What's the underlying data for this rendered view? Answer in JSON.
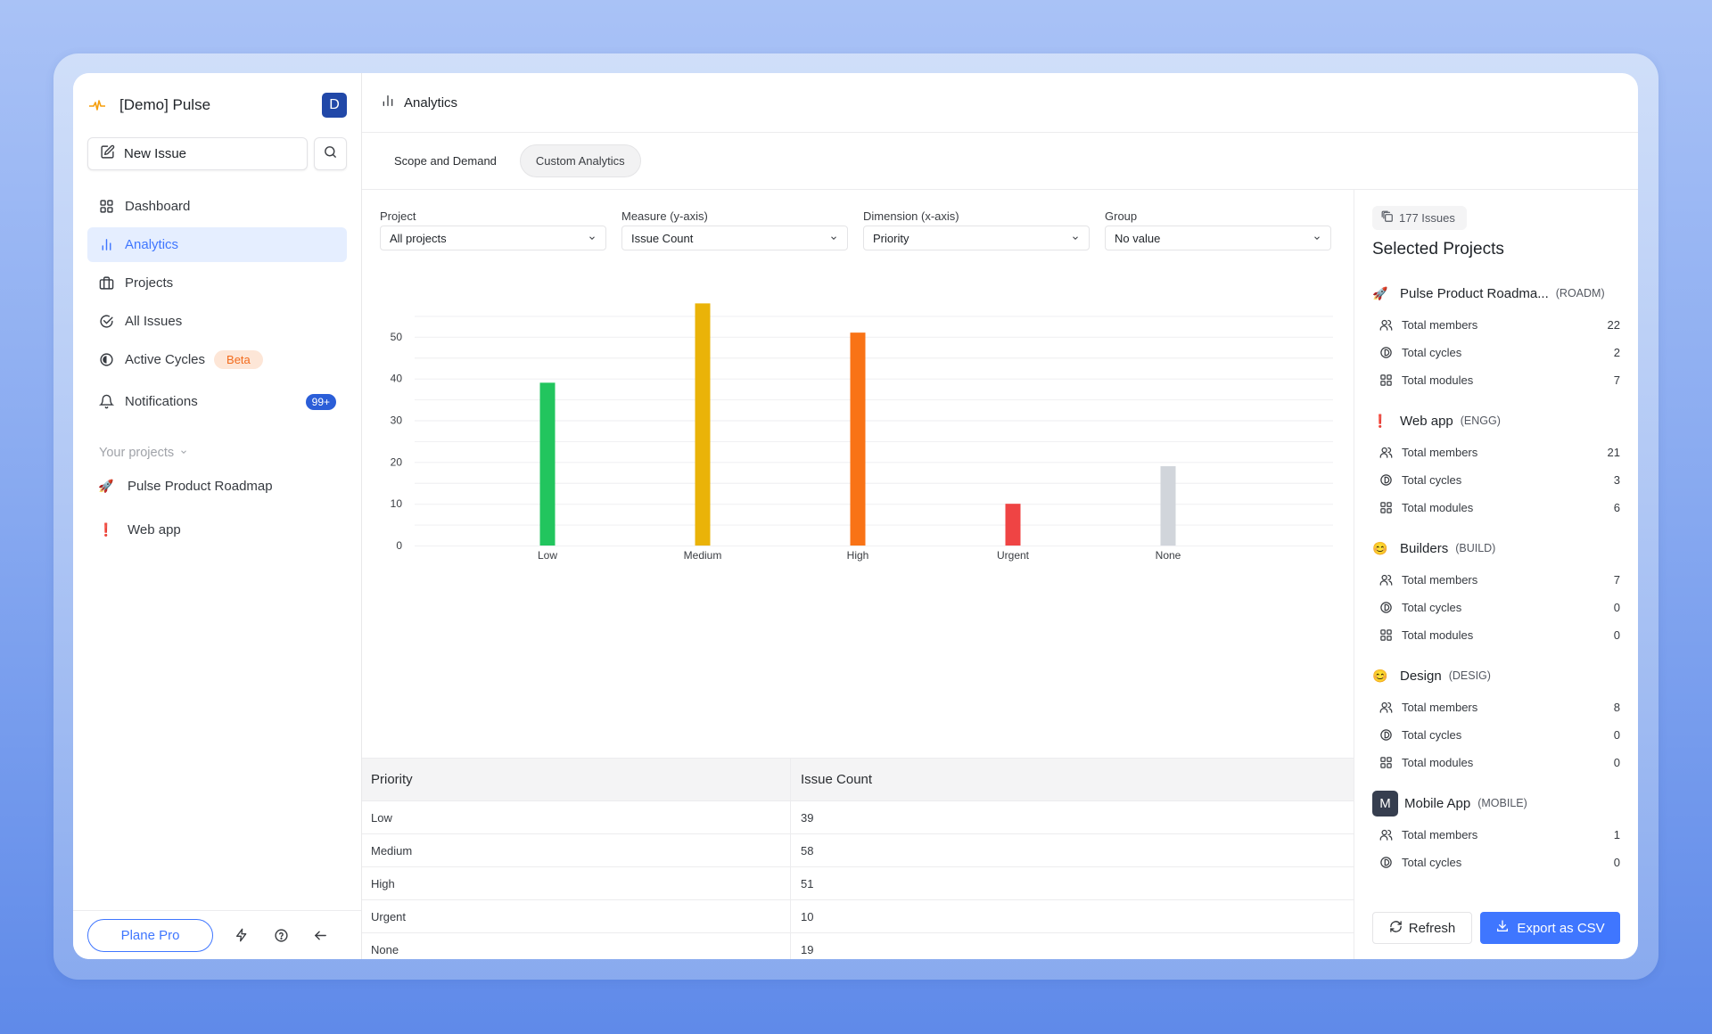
{
  "workspace": {
    "name": "[Demo] Pulse",
    "avatar_letter": "D",
    "logo_icon": "pulse-icon"
  },
  "sidebar": {
    "new_issue_label": "New Issue",
    "nav": [
      {
        "label": "Dashboard",
        "icon": "grid-icon"
      },
      {
        "label": "Analytics",
        "icon": "bar-chart-icon",
        "active": true
      },
      {
        "label": "Projects",
        "icon": "briefcase-icon"
      },
      {
        "label": "All Issues",
        "icon": "check-circle-icon"
      },
      {
        "label": "Active Cycles",
        "icon": "half-circle-icon",
        "badge": "Beta"
      },
      {
        "label": "Notifications",
        "icon": "bell-icon",
        "count": "99+"
      }
    ],
    "projects_heading": "Your projects",
    "projects": [
      {
        "label": "Pulse Product Roadmap",
        "emoji": "🚀"
      },
      {
        "label": "Web app",
        "emoji": "❗"
      }
    ],
    "footer": {
      "plan_label": "Plane Pro"
    }
  },
  "header": {
    "title": "Analytics"
  },
  "tabs": [
    {
      "label": "Scope and Demand",
      "active": false
    },
    {
      "label": "Custom Analytics",
      "active": true
    }
  ],
  "filters": [
    {
      "label": "Project",
      "value": "All projects"
    },
    {
      "label": "Measure (y-axis)",
      "value": "Issue Count"
    },
    {
      "label": "Dimension (x-axis)",
      "value": "Priority"
    },
    {
      "label": "Group",
      "value": "No value"
    }
  ],
  "chart_data": {
    "type": "bar",
    "title": "",
    "xlabel": "",
    "ylabel": "",
    "categories": [
      "Low",
      "Medium",
      "High",
      "Urgent",
      "None"
    ],
    "values": [
      39,
      58,
      51,
      10,
      19
    ],
    "colors": [
      "#22c55e",
      "#eab308",
      "#f97316",
      "#ef4444",
      "#d1d5db"
    ],
    "ylim": [
      0,
      60
    ],
    "yticks": [
      0,
      10,
      20,
      30,
      40,
      50
    ],
    "grid_step": 5,
    "grid": true,
    "legend": "none"
  },
  "table": {
    "headers": [
      "Priority",
      "Issue Count"
    ],
    "rows": [
      [
        "Low",
        "39"
      ],
      [
        "Medium",
        "58"
      ],
      [
        "High",
        "51"
      ],
      [
        "Urgent",
        "10"
      ],
      [
        "None",
        "19"
      ]
    ]
  },
  "right_panel": {
    "issues_count_label": "177 Issues",
    "title": "Selected Projects",
    "projects": [
      {
        "name": "Pulse Product Roadma...",
        "code": "(ROADM)",
        "emoji": "🚀",
        "stats": [
          {
            "label": "Total members",
            "value": "22"
          },
          {
            "label": "Total cycles",
            "value": "2"
          },
          {
            "label": "Total modules",
            "value": "7"
          }
        ]
      },
      {
        "name": "Web app",
        "code": "(ENGG)",
        "emoji": "❗",
        "stats": [
          {
            "label": "Total members",
            "value": "21"
          },
          {
            "label": "Total cycles",
            "value": "3"
          },
          {
            "label": "Total modules",
            "value": "6"
          }
        ]
      },
      {
        "name": "Builders",
        "code": "(BUILD)",
        "emoji": "😊",
        "stats": [
          {
            "label": "Total members",
            "value": "7"
          },
          {
            "label": "Total cycles",
            "value": "0"
          },
          {
            "label": "Total modules",
            "value": "0"
          }
        ]
      },
      {
        "name": "Design",
        "code": "(DESIG)",
        "emoji": "😊",
        "stats": [
          {
            "label": "Total members",
            "value": "8"
          },
          {
            "label": "Total cycles",
            "value": "0"
          },
          {
            "label": "Total modules",
            "value": "0"
          }
        ]
      },
      {
        "name": "Mobile App",
        "code": "(MOBILE)",
        "avatar_letter": "M",
        "stats": [
          {
            "label": "Total members",
            "value": "1"
          },
          {
            "label": "Total cycles",
            "value": "0"
          }
        ]
      }
    ],
    "refresh_label": "Refresh",
    "export_label": "Export as CSV"
  },
  "colors": {
    "accent": "#3f76ff",
    "active_bg": "#e5eeff",
    "beta_bg": "#fde6d7",
    "beta_text": "#f26b1d",
    "avatar": "#2148a8"
  }
}
